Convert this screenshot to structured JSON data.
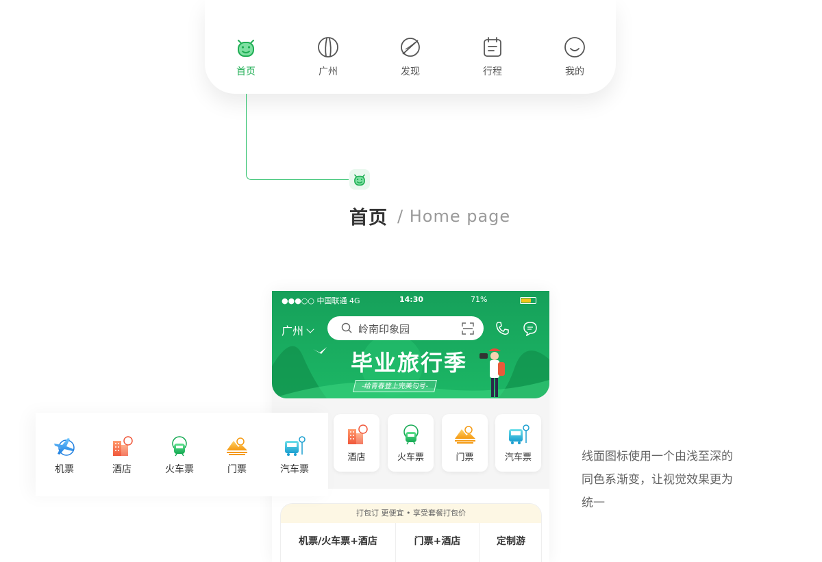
{
  "tabbar": {
    "tabs": [
      {
        "label": "首页",
        "icon": "cow-face-icon",
        "active": true
      },
      {
        "label": "广州",
        "icon": "landmark-tower-icon",
        "active": false
      },
      {
        "label": "发现",
        "icon": "planet-icon",
        "active": false
      },
      {
        "label": "行程",
        "icon": "notebook-icon",
        "active": false
      },
      {
        "label": "我的",
        "icon": "smile-face-icon",
        "active": false
      }
    ],
    "active_color": "#1fae54"
  },
  "section": {
    "title": "首页",
    "subtitle": "/ Home page"
  },
  "phone": {
    "status": {
      "carrier": "●●●○○ 中国联通  4G",
      "time": "14:30",
      "battery": "71%",
      "battery_level": 0.71
    },
    "city": "广州",
    "search_text": "岭南印象园",
    "banner": {
      "title": "毕业旅行季",
      "subtitle": "-给青春登上完美句号-"
    },
    "services": [
      {
        "label": "酒店",
        "icon": "hotel-icon"
      },
      {
        "label": "火车票",
        "icon": "train-icon"
      },
      {
        "label": "门票",
        "icon": "mountain-ticket-icon"
      },
      {
        "label": "汽车票",
        "icon": "bus-icon"
      }
    ],
    "package": {
      "header": "打包订 更便宜 • 享受套餐打包价",
      "options": [
        "机票/火车票+酒店",
        "门票+酒店",
        "定制游"
      ]
    }
  },
  "strip": [
    {
      "label": "机票",
      "icon": "plane-globe-icon"
    },
    {
      "label": "酒店",
      "icon": "hotel-icon"
    },
    {
      "label": "火车票",
      "icon": "train-icon"
    },
    {
      "label": "门票",
      "icon": "mountain-ticket-icon"
    },
    {
      "label": "汽车票",
      "icon": "bus-icon"
    }
  ],
  "description": [
    "线面图标使用一个由浅至深的",
    "同色系渐变，让视觉效果更为",
    "统一"
  ]
}
